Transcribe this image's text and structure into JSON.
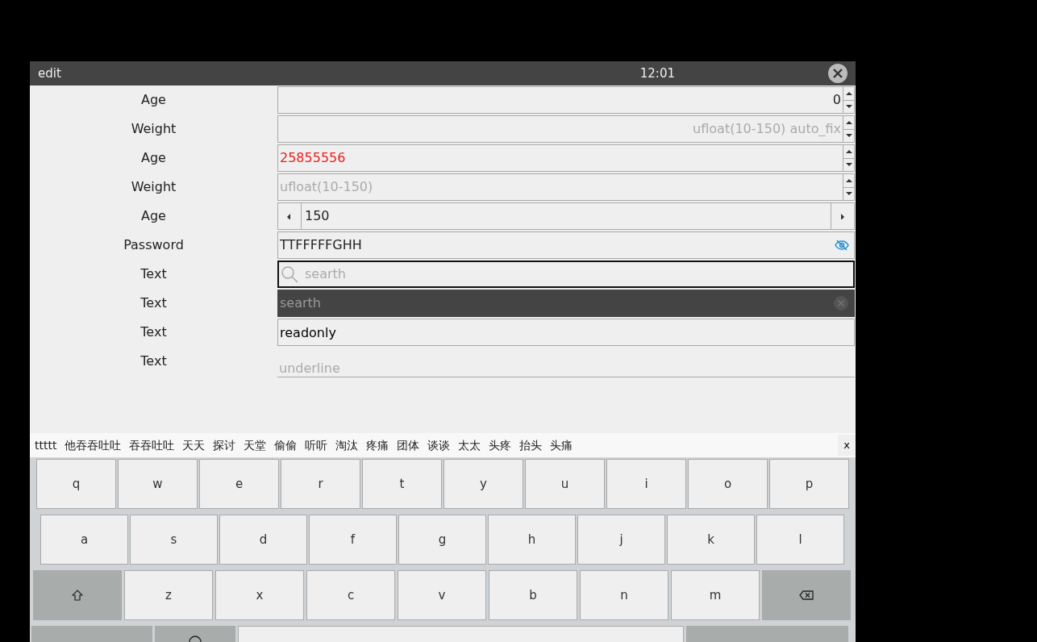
{
  "window": {
    "title": "edit",
    "time": "12:01"
  },
  "fields": [
    {
      "label": "Age",
      "kind": "spin-end",
      "value": "0"
    },
    {
      "label": "Weight",
      "kind": "spin-end",
      "placeholder": "ufloat(10-150) auto_fix"
    },
    {
      "label": "Age",
      "kind": "spin",
      "value": "25855556",
      "invalid": true
    },
    {
      "label": "Weight",
      "kind": "spin",
      "placeholder": "ufloat(10-150)"
    },
    {
      "label": "Age",
      "kind": "stepper",
      "value": "150"
    },
    {
      "label": "Password",
      "kind": "password",
      "value": "TTFFFFFGHH"
    },
    {
      "label": "Text",
      "kind": "search",
      "placeholder": "searth",
      "focused": true
    },
    {
      "label": "Text",
      "kind": "search-dark",
      "placeholder": "searth"
    },
    {
      "label": "Text",
      "kind": "readonly",
      "value": "readonly"
    },
    {
      "label": "Text",
      "kind": "underline",
      "placeholder": "underline"
    }
  ],
  "candidates": [
    "ttttt",
    "他吞吞吐吐",
    "吞吞吐吐",
    "天天",
    "探讨",
    "天堂",
    "偷偷",
    "听听",
    "淘汰",
    "疼痛",
    "团体",
    "谈谈",
    "太太",
    "头疼",
    "抬头",
    "头痛"
  ],
  "candidate_close": "x",
  "keyboard": [
    [
      {
        "kind": "letter",
        "label": "q"
      },
      {
        "kind": "letter",
        "label": "w"
      },
      {
        "kind": "letter",
        "label": "e"
      },
      {
        "kind": "letter",
        "label": "r"
      },
      {
        "kind": "letter",
        "label": "t"
      },
      {
        "kind": "letter",
        "label": "y"
      },
      {
        "kind": "letter",
        "label": "u"
      },
      {
        "kind": "letter",
        "label": "i"
      },
      {
        "kind": "letter",
        "label": "o"
      },
      {
        "kind": "letter",
        "label": "p"
      }
    ],
    [
      {
        "kind": "letter",
        "label": "a"
      },
      {
        "kind": "letter",
        "label": "s"
      },
      {
        "kind": "letter",
        "label": "d"
      },
      {
        "kind": "letter",
        "label": "f"
      },
      {
        "kind": "letter",
        "label": "g"
      },
      {
        "kind": "letter",
        "label": "h"
      },
      {
        "kind": "letter",
        "label": "j"
      },
      {
        "kind": "letter",
        "label": "k"
      },
      {
        "kind": "letter",
        "label": "l"
      }
    ],
    [
      {
        "kind": "shift"
      },
      {
        "kind": "letter",
        "label": "z"
      },
      {
        "kind": "letter",
        "label": "x"
      },
      {
        "kind": "letter",
        "label": "c"
      },
      {
        "kind": "letter",
        "label": "v"
      },
      {
        "kind": "letter",
        "label": "b"
      },
      {
        "kind": "letter",
        "label": "n"
      },
      {
        "kind": "letter",
        "label": "m"
      },
      {
        "kind": "backspace"
      }
    ],
    [
      {
        "kind": "mode"
      },
      {
        "kind": "globe"
      },
      {
        "kind": "space"
      },
      {
        "kind": "enter"
      }
    ]
  ]
}
